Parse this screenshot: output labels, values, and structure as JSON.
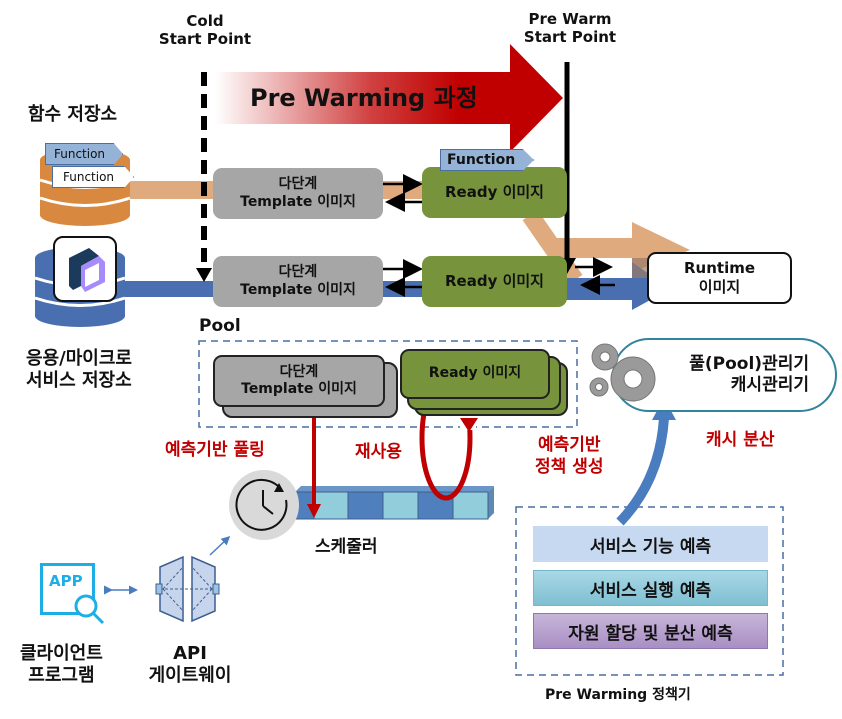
{
  "markers": {
    "cold_start": [
      "Cold",
      "Start Point"
    ],
    "pre_warm_start": [
      "Pre Warm",
      "Start Point"
    ]
  },
  "process_arrow": {
    "label": "Pre Warming 과정"
  },
  "function_store": {
    "title": "함수 저장소",
    "tags": [
      "Function",
      "Function"
    ]
  },
  "app_store": {
    "title": [
      "응용/마이크로",
      "서비스 저장소"
    ]
  },
  "row1": {
    "template": [
      "다단계",
      "Template 이미지"
    ],
    "function_tag": "Function",
    "ready": "Ready 이미지"
  },
  "row2": {
    "template": [
      "다단계",
      "Template 이미지"
    ],
    "ready": "Ready 이미지"
  },
  "runtime": [
    "Runtime",
    "이미지"
  ],
  "pool": {
    "title": "Pool",
    "template": [
      "다단계",
      "Template 이미지"
    ],
    "ready": "Ready 이미지"
  },
  "pool_manager": [
    "풀(Pool)관리기",
    "캐시관리기"
  ],
  "annotations": {
    "predictive_pooling": "예측기반 풀링",
    "reuse": "재사용",
    "predictive_policy": [
      "예측기반",
      "정책 생성"
    ],
    "cache_distribution": "캐시 분산"
  },
  "scheduler": {
    "label": "스케줄러"
  },
  "client": {
    "icon_text": "APP",
    "label": [
      "클라이언트",
      "프로그램"
    ]
  },
  "api_gateway": {
    "label": [
      "API",
      "게이트웨이"
    ]
  },
  "policy_engine": {
    "items": [
      "서비스 기능 예측",
      "서비스 실행 예측",
      "자원 할당 및 분산 예측"
    ],
    "title": "Pre Warming 정책기"
  },
  "colors": {
    "accent_red": "#c00000",
    "function_orange": "#d9893f",
    "app_blue": "#4a6fb0",
    "ready_green": "#77933c",
    "template_gray": "#a6a6a6"
  }
}
